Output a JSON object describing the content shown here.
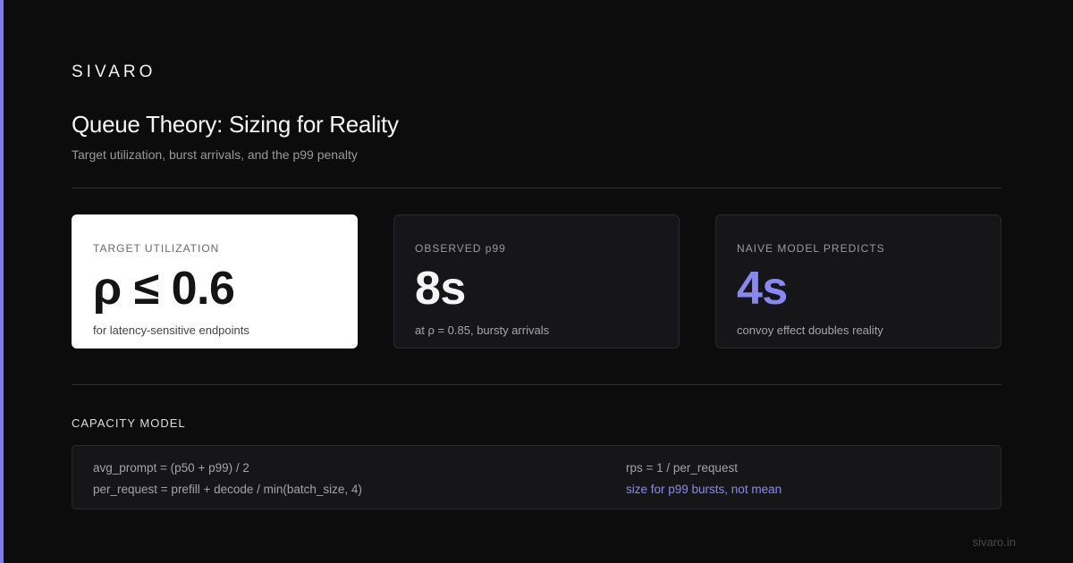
{
  "brand": "SIVARO",
  "title": "Queue Theory: Sizing for Reality",
  "subtitle": "Target utilization, burst arrivals, and the p99 penalty",
  "cards": [
    {
      "label": "TARGET UTILIZATION",
      "value": "ρ ≤ 0.6",
      "note": "for latency-sensitive endpoints"
    },
    {
      "label": "OBSERVED p99",
      "value": "8s",
      "note": "at ρ = 0.85, bursty arrivals"
    },
    {
      "label": "NAIVE MODEL PREDICTS",
      "value": "4s",
      "note": "convoy effect doubles reality"
    }
  ],
  "capacity_model": {
    "label": "CAPACITY MODEL",
    "formulas": [
      "avg_prompt = (p50 + p99) / 2",
      "per_request = prefill + decode / min(batch_size, 4)",
      "rps = 1 / per_request",
      "size for p99 bursts, not mean"
    ]
  },
  "footer": "sivaro.in",
  "colors": {
    "background": "#0c0c0c",
    "accent": "#7c7cf0",
    "card": "#161618",
    "highlight_card": "#ffffff"
  }
}
